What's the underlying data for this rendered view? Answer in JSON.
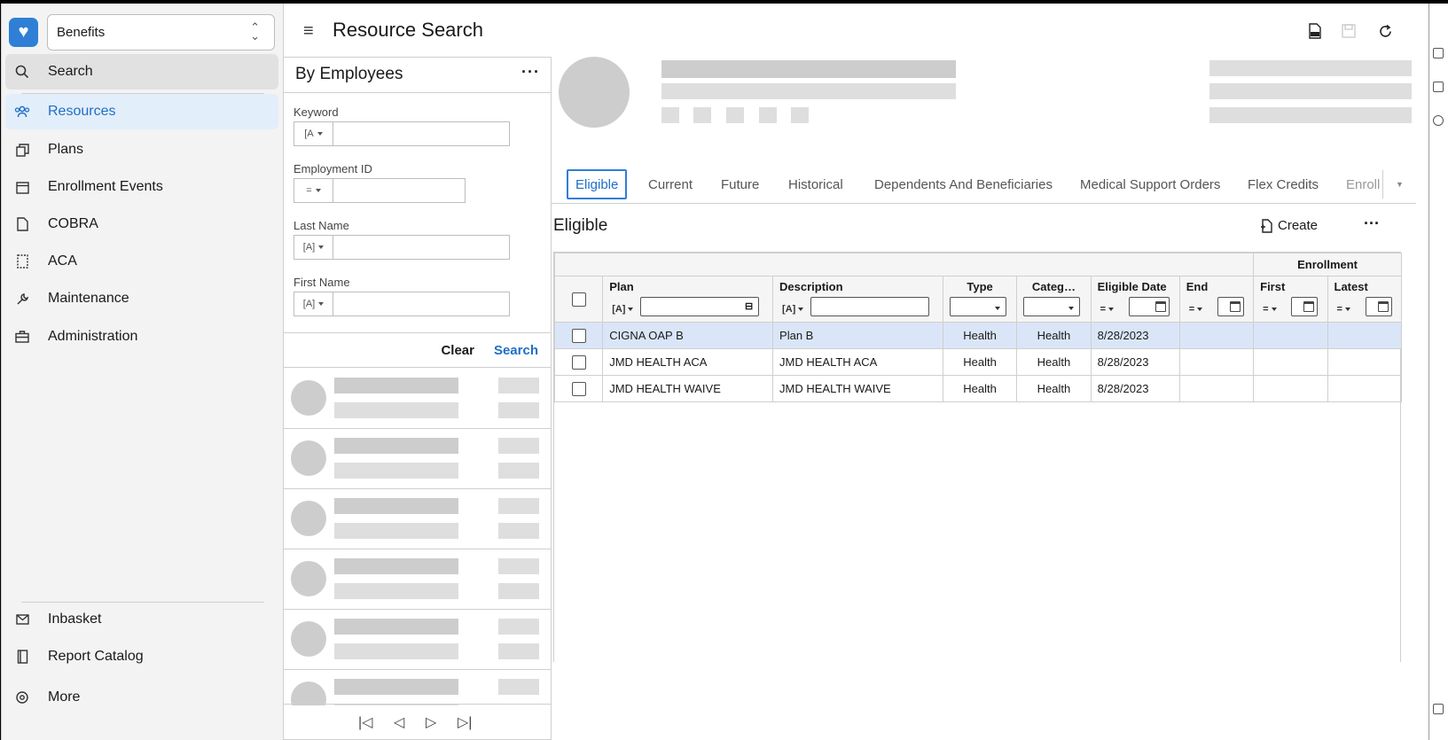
{
  "sidebar": {
    "app_select": "Benefits",
    "items": [
      {
        "label": "Search"
      },
      {
        "label": "Resources"
      },
      {
        "label": "Plans"
      },
      {
        "label": "Enrollment Events"
      },
      {
        "label": "COBRA"
      },
      {
        "label": "ACA"
      },
      {
        "label": "Maintenance"
      },
      {
        "label": "Administration"
      }
    ],
    "bottom_items": [
      {
        "label": "Inbasket"
      },
      {
        "label": "Report Catalog"
      },
      {
        "label": "More"
      }
    ]
  },
  "header": {
    "title": "Resource Search",
    "icons": [
      "pdf-icon",
      "save-icon",
      "refresh-icon"
    ]
  },
  "search_panel": {
    "title": "By Employees",
    "fields": [
      {
        "label": "Keyword",
        "operator": "[A"
      },
      {
        "label": "Employment ID",
        "operator": "="
      },
      {
        "label": "Last Name",
        "operator": "[A]"
      },
      {
        "label": "First Name",
        "operator": "[A]"
      }
    ],
    "clear_label": "Clear",
    "search_label": "Search"
  },
  "detail": {
    "tabs": [
      "Eligible",
      "Current",
      "Future",
      "Historical",
      "Dependents And Beneficiaries",
      "Medical Support Orders",
      "Flex Credits",
      "Enroll"
    ],
    "active_tab": "Eligible",
    "section_title": "Eligible",
    "create_label": "Create",
    "grid": {
      "group_header": "Enrollment",
      "columns": [
        "Plan",
        "Description",
        "Type",
        "Categ…",
        "Eligible Date",
        "End",
        "First",
        "Latest"
      ],
      "rows": [
        {
          "plan": "CIGNA OAP B",
          "description": "Plan B",
          "type": "Health",
          "category": "Health",
          "eligible_date": "8/28/2023",
          "end": "",
          "first": "",
          "latest": "",
          "selected": true
        },
        {
          "plan": "JMD HEALTH ACA",
          "description": "JMD HEALTH ACA",
          "type": "Health",
          "category": "Health",
          "eligible_date": "8/28/2023",
          "end": "",
          "first": "",
          "latest": "",
          "selected": false
        },
        {
          "plan": "JMD HEALTH WAIVE",
          "description": "JMD HEALTH WAIVE",
          "type": "Health",
          "category": "Health",
          "eligible_date": "8/28/2023",
          "end": "",
          "first": "",
          "latest": "",
          "selected": false
        }
      ]
    }
  },
  "colors": {
    "accent": "#1f6fc5",
    "selected_row": "#dae6f7",
    "sidebar_bg": "#f3f3f3",
    "placeholder": "#cdcdcd"
  }
}
